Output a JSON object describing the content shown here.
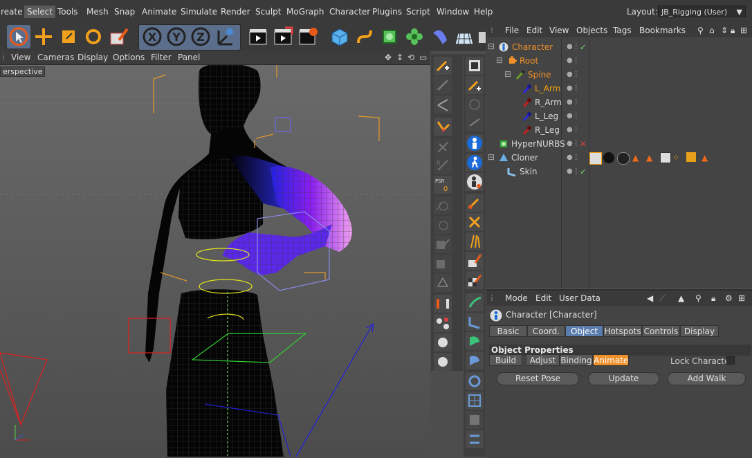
{
  "menubar": {
    "items": [
      "reate",
      "Select",
      "Tools",
      "Mesh",
      "Snap",
      "Animate",
      "Simulate",
      "Render",
      "Sculpt",
      "MoGraph",
      "Character",
      "Plugins",
      "Script",
      "Window",
      "Help"
    ],
    "active_index": 1,
    "layout_label": "Layout:",
    "layout_value": "JB_Rigging (User)"
  },
  "viewport": {
    "menu": [
      "View",
      "Cameras",
      "Display",
      "Options",
      "Filter",
      "Panel"
    ],
    "label": "erspective"
  },
  "object_manager": {
    "menu": [
      "File",
      "Edit",
      "View",
      "Objects",
      "Tags",
      "Bookmarks"
    ],
    "rows": [
      {
        "name": "Character",
        "color": "#f0902a",
        "icon": "character-icon"
      },
      {
        "name": "Root",
        "color": "#f0902a",
        "icon": "joint-icon"
      },
      {
        "name": "Spine",
        "color": "#f0902a",
        "icon": "joint-icon"
      },
      {
        "name": "L_Arm",
        "color": "#f0a010",
        "icon": "joint-icon"
      },
      {
        "name": "R_Arm",
        "color": "#d8d8d8",
        "icon": "joint-icon"
      },
      {
        "name": "L_Leg",
        "color": "#d8d8d8",
        "icon": "joint-icon"
      },
      {
        "name": "R_Leg",
        "color": "#d8d8d8",
        "icon": "joint-icon"
      },
      {
        "name": "HyperNURBS",
        "color": "#d8d8d8",
        "icon": "hypernurbs-icon"
      },
      {
        "name": "Cloner",
        "color": "#d8d8d8",
        "icon": "cloner-icon"
      },
      {
        "name": "Skin",
        "color": "#d8d8d8",
        "icon": "skin-icon"
      }
    ]
  },
  "attribute_manager": {
    "menu": [
      "Mode",
      "Edit",
      "User Data"
    ],
    "title": "Character [Character]",
    "tabs": [
      "Basic",
      "Coord.",
      "Object",
      "Hotspots",
      "Controls",
      "Display"
    ],
    "selected_tab": "Object",
    "section": "Object Properties",
    "subtabs": [
      "Build",
      "Adjust",
      "Binding",
      "Animate"
    ],
    "selected_subtab": "Animate",
    "lock_label": "Lock Character",
    "buttons": [
      "Reset Pose",
      "Update",
      "Add Walk"
    ]
  },
  "colors": {
    "accent_orange": "#f0902a",
    "selected_blue": "#5b7dad",
    "check_green": "#6bd46b",
    "cross_red": "#e04040"
  }
}
